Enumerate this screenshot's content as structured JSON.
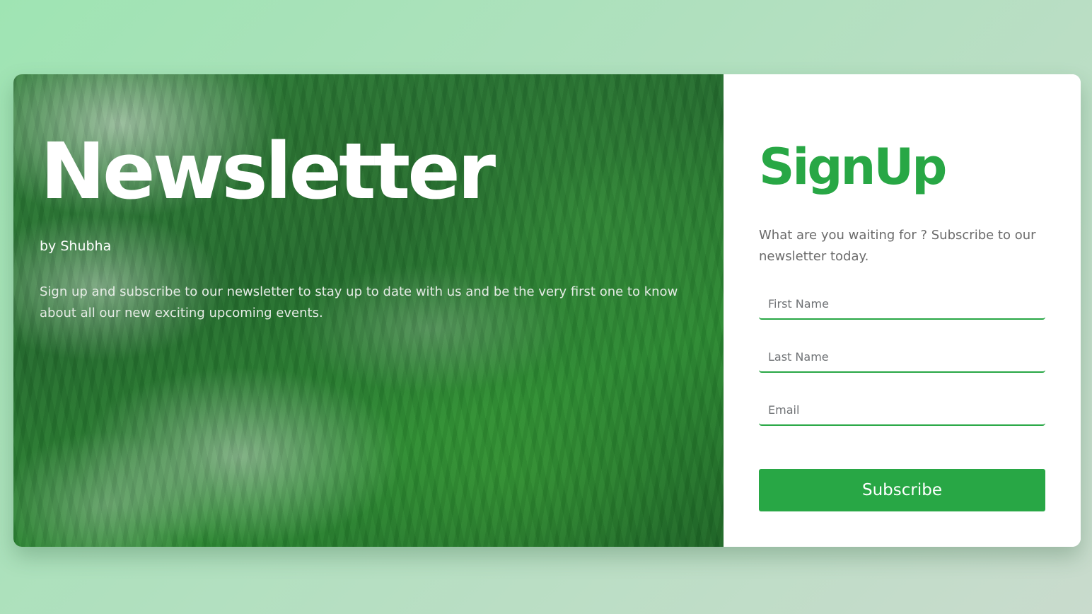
{
  "hero": {
    "title": "Newsletter",
    "author": "by Shubha",
    "description": "Sign up and subscribe to our newsletter to stay up to date with us and be the very first one to know about all our new exciting upcoming events."
  },
  "signup": {
    "title": "SignUp",
    "description": "What are you waiting for ? Subscribe to our newsletter today.",
    "fields": [
      {
        "placeholder": "First Name",
        "value": ""
      },
      {
        "placeholder": "Last Name",
        "value": ""
      },
      {
        "placeholder": "Email",
        "value": ""
      }
    ],
    "button_label": "Subscribe"
  },
  "colors": {
    "accent": "#28a745",
    "background": "#a8e2bc"
  }
}
